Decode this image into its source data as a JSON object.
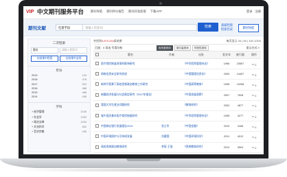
{
  "header": {
    "logo": "VIP",
    "title": "中文期刊服务平台",
    "nav": [
      "期刊导航",
      "期刊评价报告",
      "期刊开放获取",
      "下载APP"
    ],
    "top_links": [
      "登录",
      "注册"
    ]
  },
  "search": {
    "brand": "期刊文献",
    "scope": "任意字段",
    "placeholder": "请输入检索词",
    "button": "检索",
    "adv_links": [
      "高级检索",
      "检索历史"
    ],
    "journal_nav_button": "期刊导航"
  },
  "sidebar": {
    "title": "二次检索",
    "scope": "题名",
    "input_placeholder": "请输入检索词",
    "buttons": [
      "在结果中检索",
      "在结果中去除"
    ],
    "year_heading": "年份",
    "years": [
      {
        "label": "2019",
        "count": "134"
      },
      {
        "label": "2018",
        "count": "478"
      },
      {
        "label": "2017",
        "count": "523"
      },
      {
        "label": "2016",
        "count": "488"
      },
      {
        "label": "2015",
        "count": "468"
      },
      {
        "label": "2014",
        "count": "436"
      }
    ],
    "subject_heading": "学科",
    "subjects": [
      {
        "label": "经济管理",
        "count": "2135"
      },
      {
        "label": "社会学",
        "count": "1234"
      },
      {
        "label": "政治法律",
        "count": "1234"
      },
      {
        "label": "文化科学",
        "count": "842"
      },
      {
        "label": "哲学宗教",
        "count": "435"
      }
    ]
  },
  "results": {
    "summary_prefix": "共找到",
    "summary_count": "5,870,254",
    "summary_suffix": "条结果",
    "pager": "每页显示 20 | 50 | 100   1/200",
    "toolbar_left": "已选：0   导出   引用分析",
    "sorts": [
      {
        "label": "相关度排序",
        "active": true
      },
      {
        "label": "被引量排序",
        "active": false
      },
      {
        "label": "时效性排序",
        "active": false
      }
    ],
    "toolbar_right": "显示方式 ≡",
    "columns": [
      "",
      "题名",
      "作者",
      "出处",
      "发文年",
      "被引量",
      "操作"
    ],
    "rows": [
      {
        "title": "医疗保险制度改革的影响研究",
        "author": "",
        "source": "《中华医院管理杂志》",
        "year": "1996",
        "cited": "23557"
      },
      {
        "title": "网络信息安全研究综述",
        "author": "",
        "source": "《中国管理信息化》",
        "year": "2000",
        "cited": "14407"
      },
      {
        "title": "新时代背景下高校思想政治教育工作研究",
        "author": "",
        "source": "《中国高等教育》",
        "year": "1995",
        "cited": "10258"
      },
      {
        "title": "新疆经济发展与社会稳定研究（2007年报告）",
        "author": "",
        "source": "《中国发展观察》",
        "year": "2007",
        "cited": "7628"
      },
      {
        "title": "我国大学生就业问题研究",
        "author": "",
        "source": "《教育研究》",
        "year": "2002",
        "cited": "4877"
      },
      {
        "title": "城乡居民基本医疗保险制度研究",
        "author": "",
        "source": "《中华医院管理杂志》",
        "year": "1995",
        "cited": "4277"
      },
      {
        "title": "中国商业银行发展报告2010",
        "author": "张立华",
        "source": "《中国金融》",
        "year": "2010",
        "cited": "4166"
      },
      {
        "title": "中国环境保护与可持续发展",
        "author": "刘建国",
        "source": "《中国环境科学》",
        "year": "2011",
        "cited": "4012"
      },
      {
        "title": "高校思想政治教育研究",
        "author": "李丽 王强",
        "source": "《思想教育研究》",
        "year": "2012",
        "cited": "3904"
      }
    ]
  }
}
